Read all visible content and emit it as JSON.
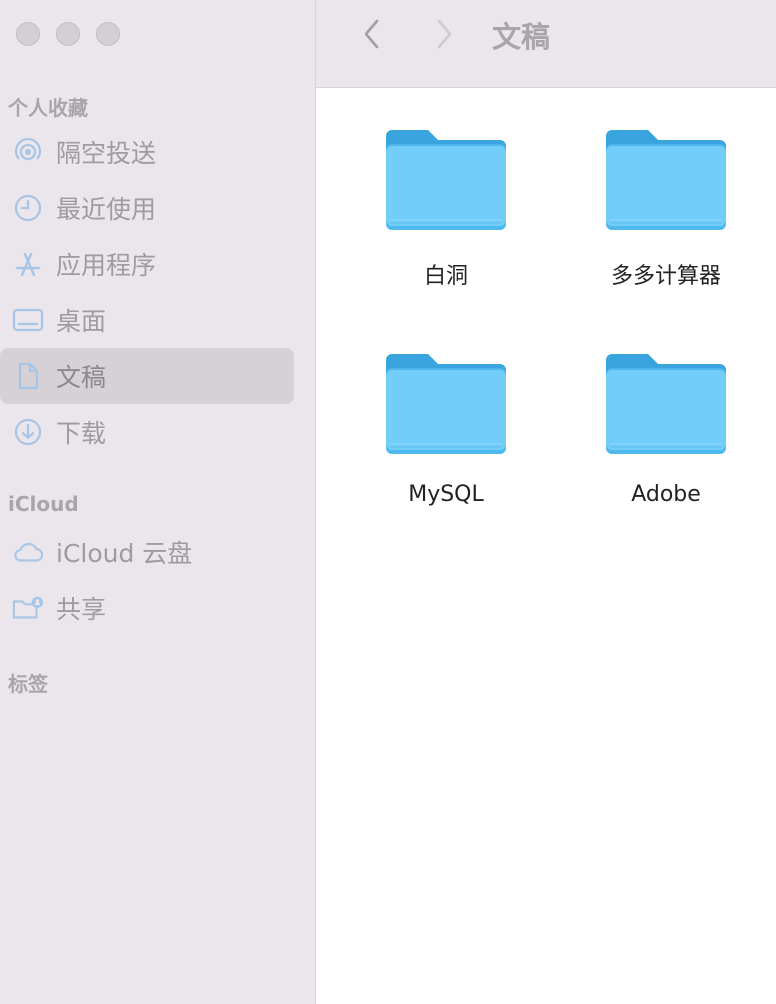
{
  "sidebar": {
    "sections": {
      "favorites": "个人收藏",
      "icloud": "iCloud",
      "tags": "标签"
    },
    "favorites": [
      {
        "label": "隔空投送",
        "icon": "airdrop-icon"
      },
      {
        "label": "最近使用",
        "icon": "clock-icon"
      },
      {
        "label": "应用程序",
        "icon": "applications-icon"
      },
      {
        "label": "桌面",
        "icon": "desktop-icon"
      },
      {
        "label": "文稿",
        "icon": "document-icon",
        "selected": true
      },
      {
        "label": "下载",
        "icon": "download-icon"
      }
    ],
    "icloud_items": [
      {
        "label": "iCloud 云盘",
        "icon": "cloud-icon"
      },
      {
        "label": "共享",
        "icon": "shared-folder-icon"
      }
    ]
  },
  "toolbar": {
    "title": "文稿"
  },
  "files": [
    {
      "name": "白洞"
    },
    {
      "name": "多多计算器"
    },
    {
      "name": "MySQL"
    },
    {
      "name": "Adobe"
    }
  ],
  "colors": {
    "sidebar_bg": "#ebe5ec",
    "selection_bg": "#d6d0d7",
    "icon_blue": "#a7c6e6",
    "folder_light": "#72cdf8",
    "folder_dark": "#3aa4de"
  }
}
